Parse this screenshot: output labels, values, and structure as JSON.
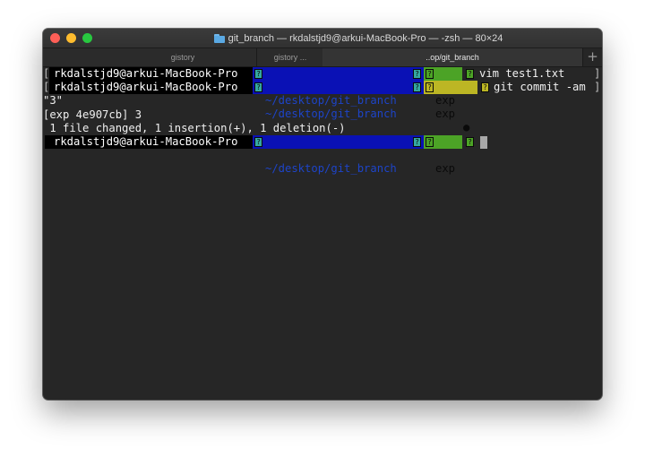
{
  "window": {
    "title": "git_branch — rkdalstjd9@arkui-MacBook-Pro — -zsh — 80×24",
    "tabs": [
      {
        "label": "gistory",
        "active": false
      },
      {
        "label": "gistory ...",
        "active": false
      },
      {
        "label": "..op/git_branch",
        "active": true
      }
    ],
    "new_tab_symbol": "+"
  },
  "prompt": {
    "user_host": "rkdalstjd9@arkui-MacBook-Pro",
    "path": "~/desktop/git_branch",
    "branch": "exp",
    "dirty_marker": "●",
    "glyph": "?"
  },
  "lines": [
    {
      "type": "prompt",
      "branch_state": "clean",
      "command": "vim test1.txt",
      "left_bracket": "[",
      "right_bracket": "]"
    },
    {
      "type": "prompt",
      "branch_state": "dirty",
      "command": "git commit -am",
      "left_bracket": "[",
      "right_bracket": "]"
    },
    {
      "type": "output",
      "text": "\"3\""
    },
    {
      "type": "output",
      "text": "[exp 4e907cb] 3"
    },
    {
      "type": "output",
      "text": " 1 file changed, 1 insertion(+), 1 deletion(-)"
    },
    {
      "type": "prompt",
      "branch_state": "clean",
      "command": ""
    }
  ],
  "colors": {
    "background": "#262626",
    "segment_user": "#000000",
    "segment_path": "#0a11b5",
    "segment_clean": "#4ca326",
    "segment_dirty": "#bcb624"
  }
}
